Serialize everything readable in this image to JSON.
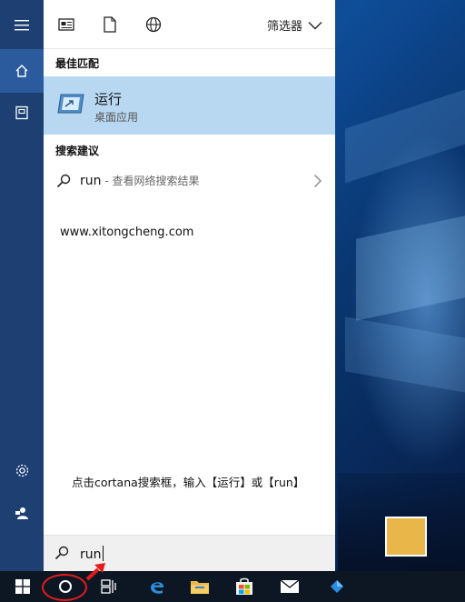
{
  "toolbar": {
    "filter_label": "筛选器",
    "icons": [
      "news-icon",
      "document-icon",
      "globe-icon"
    ]
  },
  "sections": {
    "best_match": "最佳匹配",
    "suggestions": "搜索建议"
  },
  "best_match": {
    "name": "运行",
    "type": "桌面应用"
  },
  "suggestion": {
    "query": "run",
    "hint": " - 查看网络搜索结果"
  },
  "watermark": "www.xitongcheng.com",
  "instruction": "点击cortana搜索框，输入【运行】或【run】",
  "search": {
    "value": "run"
  },
  "rail": [
    "hamburger-icon",
    "home-icon",
    "notebook-icon",
    "settings-icon",
    "feedback-icon"
  ],
  "taskbar": [
    "windows-start-icon",
    "cortana-icon",
    "task-view-icon",
    "edge-icon",
    "file-explorer-icon",
    "store-icon",
    "mail-icon"
  ],
  "colors": {
    "rail": "#1d3f72",
    "rail_active": "#2b5b9c",
    "highlight": "#b8d8f2",
    "taskbar": "#0d1724",
    "annotation_red": "#e21b1b"
  }
}
